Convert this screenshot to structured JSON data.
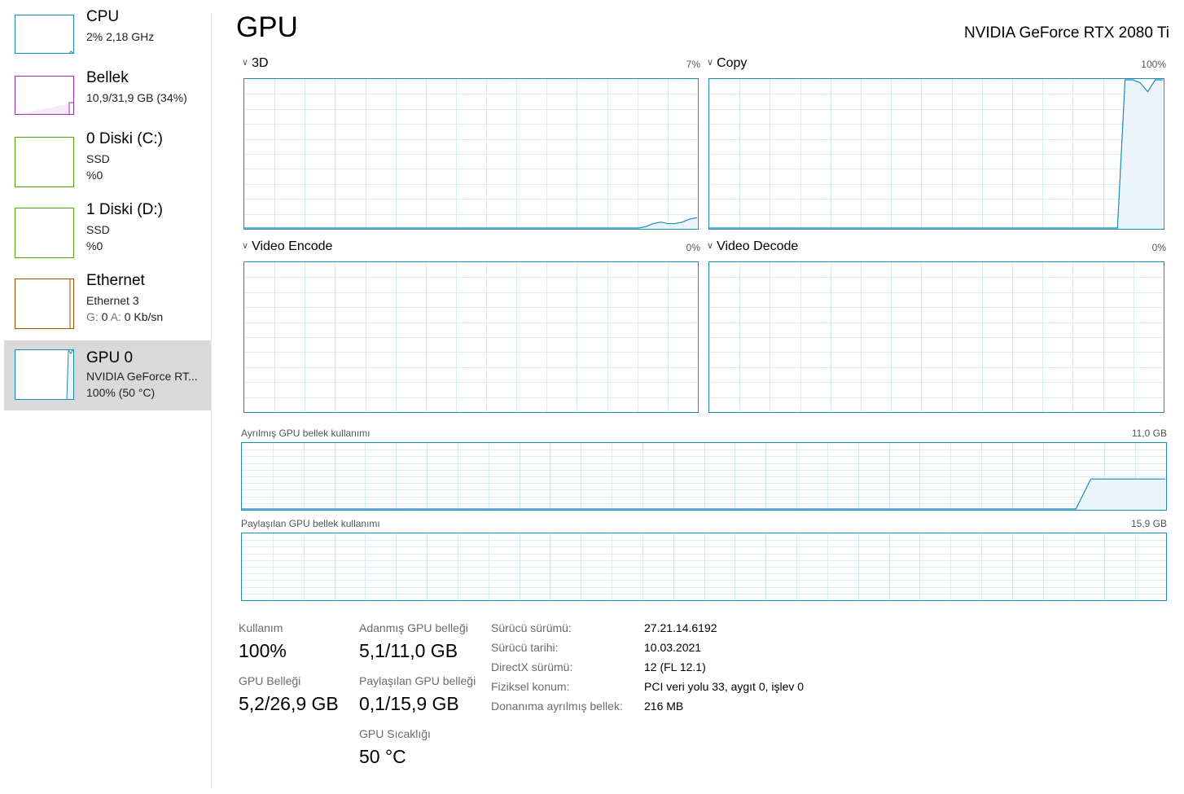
{
  "colors": {
    "cpu": "#1e8ab8",
    "memory": "#9b2fae",
    "disk": "#4da60c",
    "ethernet": "#a74f01",
    "gpu": "#1e8ab8",
    "selected_bg": "#d9d9d9"
  },
  "sidebar": {
    "items": [
      {
        "title": "CPU",
        "line1": "2%  2,18 GHz",
        "line2": ""
      },
      {
        "title": "Bellek",
        "line1": "10,9/31,9 GB (34%)",
        "line2": ""
      },
      {
        "title": "0 Diski (C:)",
        "line1": "SSD",
        "line2": "%0"
      },
      {
        "title": "1 Diski (D:)",
        "line1": "SSD",
        "line2": "%0"
      },
      {
        "title": "Ethernet",
        "line1": "Ethernet 3",
        "line2_send_label": "G:",
        "line2_send": "0",
        "line2_recv_label": "A:",
        "line2_recv": "0 Kb/sn"
      },
      {
        "title": "GPU 0",
        "line1": "NVIDIA GeForce RT...",
        "line2": "100%  (50 °C)",
        "selected": true
      }
    ]
  },
  "header": {
    "title": "GPU",
    "device": "NVIDIA GeForce RTX 2080 Ti"
  },
  "engines": [
    {
      "name": "3D",
      "percent": "7%",
      "history_pct": [
        0,
        0,
        0,
        0,
        0,
        0,
        0,
        0,
        0,
        0,
        0,
        0,
        0,
        0,
        0,
        0,
        0,
        0,
        0,
        0,
        0,
        0,
        0,
        0,
        0,
        0,
        0,
        0,
        0,
        0,
        0,
        0,
        0,
        0,
        0,
        0,
        0,
        0,
        0,
        0,
        0,
        0,
        0,
        0,
        0,
        0,
        0,
        0,
        0,
        0,
        0,
        0,
        0,
        0,
        0,
        1,
        3,
        4,
        3,
        3,
        4,
        6,
        7
      ]
    },
    {
      "name": "Copy",
      "percent": "100%",
      "history_pct": [
        0,
        0,
        0,
        0,
        0,
        0,
        0,
        0,
        0,
        0,
        0,
        0,
        0,
        0,
        0,
        0,
        0,
        0,
        0,
        0,
        0,
        0,
        0,
        0,
        0,
        0,
        0,
        0,
        0,
        0,
        0,
        0,
        0,
        0,
        0,
        0,
        0,
        0,
        0,
        0,
        0,
        0,
        0,
        0,
        0,
        0,
        0,
        0,
        0,
        0,
        0,
        0,
        0,
        0,
        0,
        100,
        100,
        98,
        92,
        100,
        100
      ]
    },
    {
      "name": "Video Encode",
      "percent": "0%",
      "history_pct": []
    },
    {
      "name": "Video Decode",
      "percent": "0%",
      "history_pct": []
    }
  ],
  "memory_graphs": {
    "dedicated": {
      "label": "Ayrılmış GPU bellek kullanımı",
      "max": "11,0 GB",
      "history_pct": [
        0,
        0,
        0,
        0,
        0,
        0,
        0,
        0,
        0,
        0,
        0,
        0,
        0,
        0,
        0,
        0,
        0,
        0,
        0,
        0,
        0,
        0,
        0,
        0,
        0,
        0,
        0,
        0,
        0,
        0,
        0,
        0,
        0,
        0,
        0,
        0,
        0,
        0,
        0,
        0,
        0,
        0,
        0,
        0,
        0,
        0,
        0,
        0,
        0,
        0,
        0,
        0,
        0,
        0,
        0,
        0,
        0,
        46,
        46,
        46,
        46,
        46,
        46
      ]
    },
    "shared": {
      "label": "Paylaşılan GPU bellek kullanımı",
      "max": "15,9 GB",
      "history_pct": []
    }
  },
  "stats": {
    "usage": {
      "label": "Kullanım",
      "value": "100%"
    },
    "gpu_memory": {
      "label": "GPU Belleği",
      "value": "5,2/26,9 GB"
    },
    "dedicated_memory": {
      "label": "Adanmış GPU belleği",
      "value": "5,1/11,0 GB"
    },
    "shared_memory": {
      "label": "Paylaşılan GPU belleği",
      "value": "0,1/15,9 GB"
    },
    "temperature": {
      "label": "GPU Sıcaklığı",
      "value": "50 °C"
    }
  },
  "info": [
    {
      "label": "Sürücü sürümü:",
      "value": "27.21.14.6192"
    },
    {
      "label": "Sürücü tarihi:",
      "value": "10.03.2021"
    },
    {
      "label": "DirectX sürümü:",
      "value": "12 (FL 12.1)"
    },
    {
      "label": "Fiziksel konum:",
      "value": "PCI veri yolu 33, aygıt 0, işlev 0"
    },
    {
      "label": "Donanıma ayrılmış bellek:",
      "value": "216 MB"
    }
  ],
  "icons": {
    "collapse": "chevron-down-icon"
  }
}
